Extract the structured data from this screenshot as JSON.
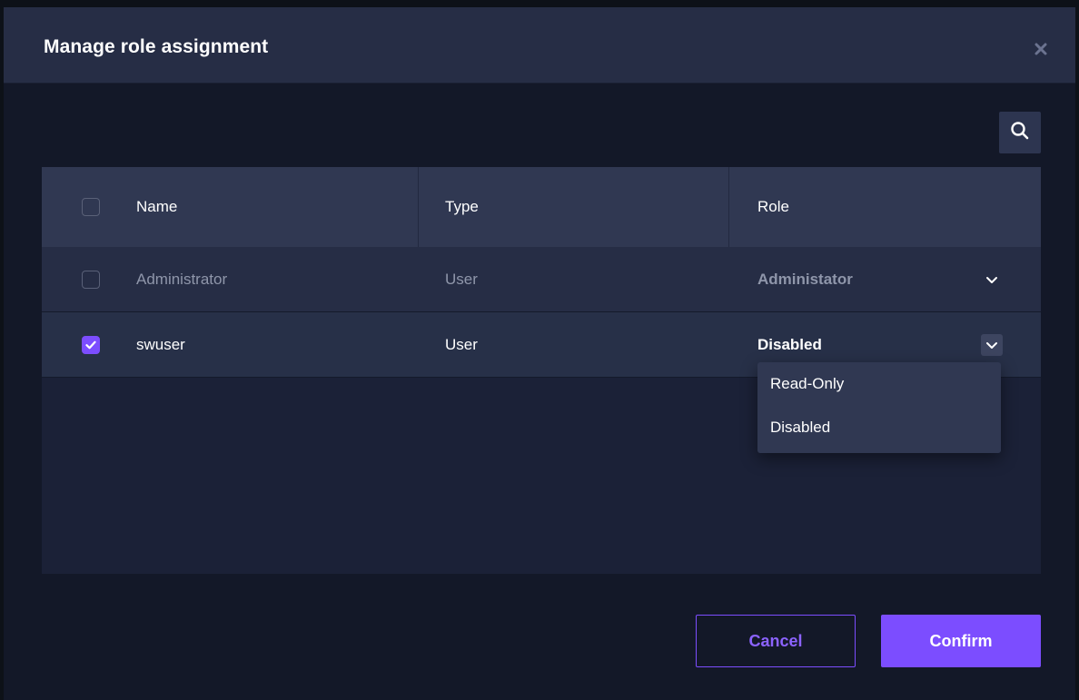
{
  "dialog": {
    "title": "Manage role assignment",
    "close_icon": "close-icon",
    "search_icon": "search-icon"
  },
  "table": {
    "columns": [
      "Name",
      "Type",
      "Role"
    ],
    "rows": [
      {
        "name": "Administrator",
        "type": "User",
        "role": "Administator",
        "selected": false
      },
      {
        "name": "swuser",
        "type": "User",
        "role": "Disabled",
        "selected": true
      }
    ]
  },
  "role_dropdown": {
    "options": [
      "Read-Only",
      "Disabled"
    ]
  },
  "footer": {
    "cancel_label": "Cancel",
    "confirm_label": "Confirm"
  },
  "colors": {
    "accent": "#7c4dff",
    "header_bg": "#262d45",
    "dialog_bg": "#131828",
    "table_header_bg": "#303852"
  }
}
